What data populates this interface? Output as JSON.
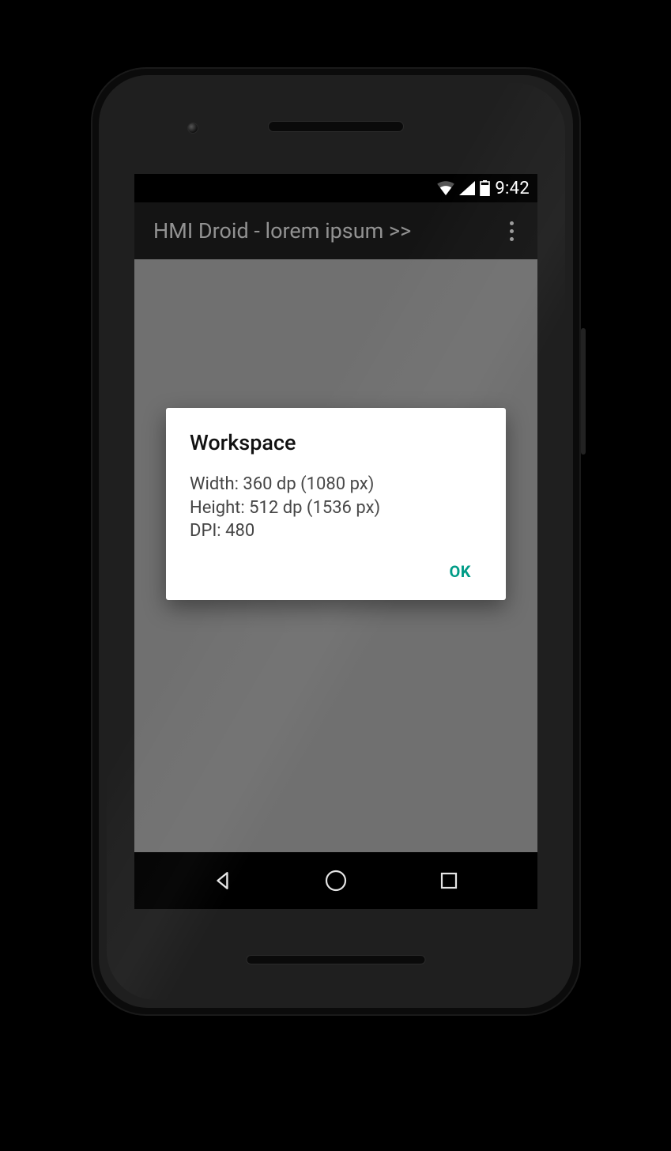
{
  "statusbar": {
    "time": "9:42"
  },
  "actionbar": {
    "title": "HMI Droid - lorem ipsum >>"
  },
  "dialog": {
    "title": "Workspace",
    "width_line": "Width: 360 dp (1080 px)",
    "height_line": "Height: 512 dp (1536 px)",
    "dpi_line": "DPI: 480",
    "ok_label": "OK"
  },
  "colors": {
    "accent": "#009c87"
  }
}
